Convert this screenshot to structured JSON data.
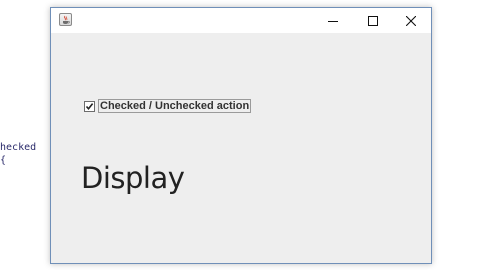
{
  "background_editor": {
    "lines": [
      "checked",
      "{"
    ]
  },
  "window": {
    "title": "",
    "icon": "java-coffee-icon",
    "controls": {
      "minimize_icon": "minimize-icon",
      "maximize_icon": "maximize-icon",
      "close_icon": "close-icon"
    }
  },
  "content": {
    "checkbox": {
      "label": "Checked / Unchecked action",
      "checked": true
    },
    "display_label": "Display"
  },
  "colors": {
    "window_border": "#6f8fb8",
    "content_bg": "#eeeeee",
    "titlebar_bg": "#ffffff"
  }
}
